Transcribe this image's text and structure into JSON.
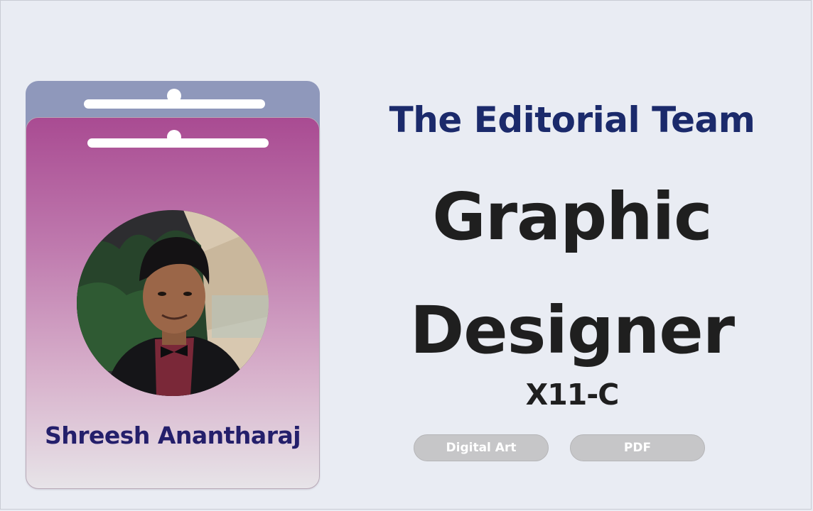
{
  "badge": {
    "name": "Shreesh Anantharaj",
    "photo": "profile-photo"
  },
  "header": {
    "team": "The Editorial Team"
  },
  "role": {
    "line1": "Graphic",
    "line2": "Designer"
  },
  "class_code": "X11-C",
  "tags": [
    {
      "label": "Digital Art"
    },
    {
      "label": "PDF"
    }
  ],
  "colors": {
    "background": "#e9ecf3",
    "badge_back": "#8f98bb",
    "badge_gradient_top": "#a94b92",
    "name_text": "#241f6b",
    "team_text": "#1b2a6b",
    "role_text": "#1f1f1f",
    "pill_bg": "#c6c6c8"
  }
}
